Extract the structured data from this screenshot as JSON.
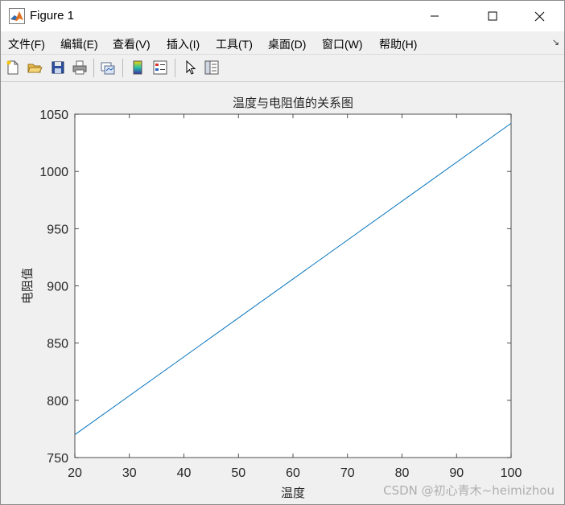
{
  "window": {
    "title": "Figure 1"
  },
  "menu": [
    {
      "label": "文件(F)"
    },
    {
      "label": "编辑(E)"
    },
    {
      "label": "查看(V)"
    },
    {
      "label": "插入(I)"
    },
    {
      "label": "工具(T)"
    },
    {
      "label": "桌面(D)"
    },
    {
      "label": "窗口(W)"
    },
    {
      "label": "帮助(H)"
    }
  ],
  "toolbar": {
    "icons": [
      "new-figure-icon",
      "open-file-icon",
      "save-icon",
      "print-icon",
      "link-plot-icon",
      "colorbar-icon",
      "legend-icon",
      "select-pointer-icon",
      "property-inspector-icon"
    ]
  },
  "watermark": "CSDN @初心青木~heimizhou",
  "colors": {
    "line": "#0072bd",
    "figure_bg": "#f0f0f0",
    "axes_bg": "#ffffff"
  },
  "chart_data": {
    "type": "line",
    "title": "温度与电阻值的关系图",
    "xlabel": "温度",
    "ylabel": "电阻值",
    "xlim": [
      20,
      100
    ],
    "ylim": [
      750,
      1050
    ],
    "xticks": [
      20,
      30,
      40,
      50,
      60,
      70,
      80,
      90,
      100
    ],
    "yticks": [
      750,
      800,
      850,
      900,
      950,
      1000,
      1050
    ],
    "grid": false,
    "series": [
      {
        "x": [
          20,
          100
        ],
        "y": [
          770,
          1042
        ]
      }
    ]
  }
}
